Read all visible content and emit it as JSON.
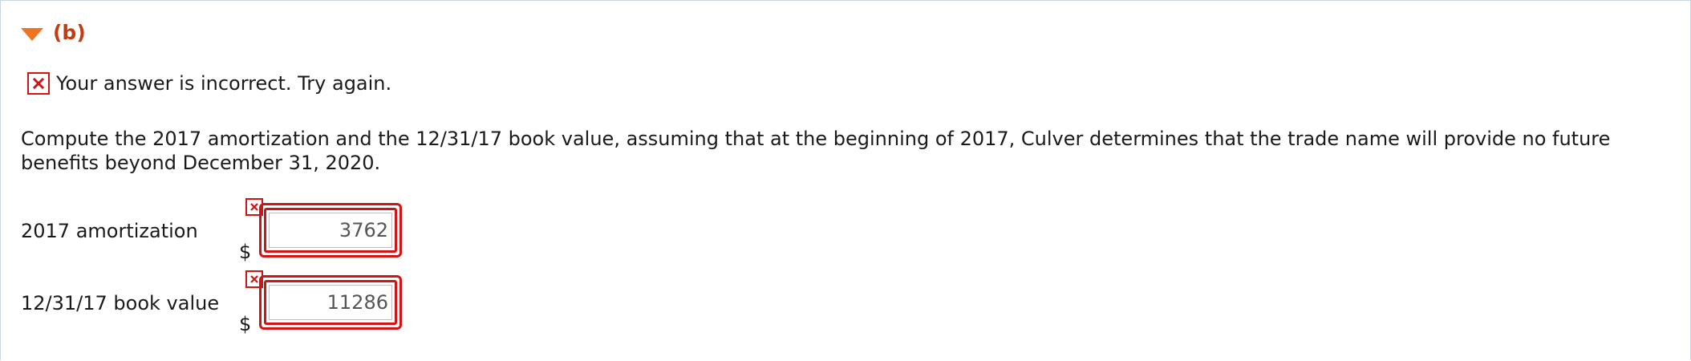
{
  "part": {
    "label": "(b)"
  },
  "feedback": {
    "message": "Your answer is incorrect.  Try again."
  },
  "question": {
    "text": "Compute the 2017 amortization and the 12/31/17 book value, assuming that at the beginning of 2017, Culver determines that the trade name will provide no future benefits beyond December 31, 2020."
  },
  "answers": [
    {
      "label": "2017 amortization",
      "currency": "$",
      "value": "3762",
      "status": "incorrect"
    },
    {
      "label": "12/31/17 book value",
      "currency": "$",
      "value": "11286",
      "status": "incorrect"
    }
  ],
  "colors": {
    "triangle": "#f07321",
    "part_label": "#c43b10",
    "error": "#d11515",
    "border": "#c8d6e3"
  }
}
